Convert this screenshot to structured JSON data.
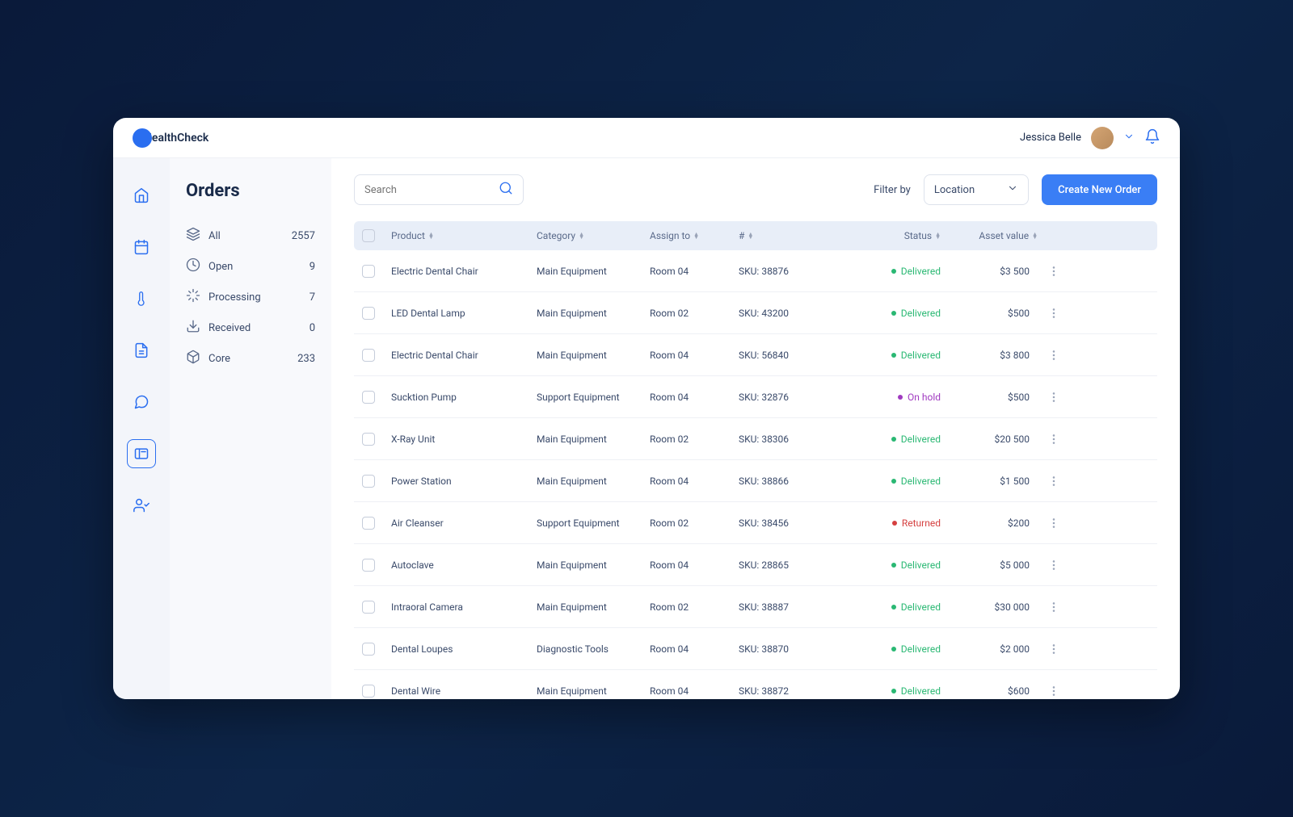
{
  "brand": "HealthCheck",
  "user": {
    "name": "Jessica Belle"
  },
  "sidebar": {
    "title": "Orders",
    "filters": [
      {
        "label": "All",
        "count": "2557",
        "icon": "layers"
      },
      {
        "label": "Open",
        "count": "9",
        "icon": "clock"
      },
      {
        "label": "Processing",
        "count": "7",
        "icon": "loader"
      },
      {
        "label": "Received",
        "count": "0",
        "icon": "download"
      },
      {
        "label": "Core",
        "count": "233",
        "icon": "box"
      }
    ]
  },
  "toolbar": {
    "search_placeholder": "Search",
    "filter_by_label": "Filter by",
    "location_label": "Location",
    "create_button": "Create New Order"
  },
  "columns": {
    "product": "Product",
    "category": "Category",
    "assign_to": "Assign to",
    "number": "#",
    "status": "Status",
    "asset_value": "Asset value"
  },
  "status_labels": {
    "delivered": "Delivered",
    "onhold": "On hold",
    "returned": "Returned"
  },
  "rows": [
    {
      "product": "Electric Dental Chair",
      "category": "Main Equipment",
      "assign": "Room 04",
      "sku": "SKU: 38876",
      "status": "delivered",
      "asset": "$3 500"
    },
    {
      "product": "LED Dental Lamp",
      "category": "Main Equipment",
      "assign": "Room 02",
      "sku": "SKU: 43200",
      "status": "delivered",
      "asset": "$500"
    },
    {
      "product": "Electric Dental Chair",
      "category": "Main Equipment",
      "assign": "Room 04",
      "sku": "SKU: 56840",
      "status": "delivered",
      "asset": "$3 800"
    },
    {
      "product": "Sucktion Pump",
      "category": "Support Equipment",
      "assign": "Room 04",
      "sku": "SKU: 32876",
      "status": "onhold",
      "asset": "$500"
    },
    {
      "product": "X-Ray Unit",
      "category": "Main Equipment",
      "assign": "Room 02",
      "sku": "SKU: 38306",
      "status": "delivered",
      "asset": "$20 500"
    },
    {
      "product": "Power Station",
      "category": "Main Equipment",
      "assign": "Room 04",
      "sku": "SKU: 38866",
      "status": "delivered",
      "asset": "$1 500"
    },
    {
      "product": "Air Cleanser",
      "category": "Support Equipment",
      "assign": "Room 02",
      "sku": "SKU: 38456",
      "status": "returned",
      "asset": "$200"
    },
    {
      "product": "Autoclave",
      "category": "Main Equipment",
      "assign": "Room 04",
      "sku": "SKU: 28865",
      "status": "delivered",
      "asset": "$5 000"
    },
    {
      "product": "Intraoral Camera",
      "category": "Main Equipment",
      "assign": "Room 02",
      "sku": "SKU: 38887",
      "status": "delivered",
      "asset": "$30 000"
    },
    {
      "product": "Dental Loupes",
      "category": "Diagnostic Tools",
      "assign": "Room 04",
      "sku": "SKU: 38870",
      "status": "delivered",
      "asset": "$2 000"
    },
    {
      "product": "Dental Wire",
      "category": "Main Equipment",
      "assign": "Room 04",
      "sku": "SKU: 38872",
      "status": "delivered",
      "asset": "$600"
    }
  ]
}
